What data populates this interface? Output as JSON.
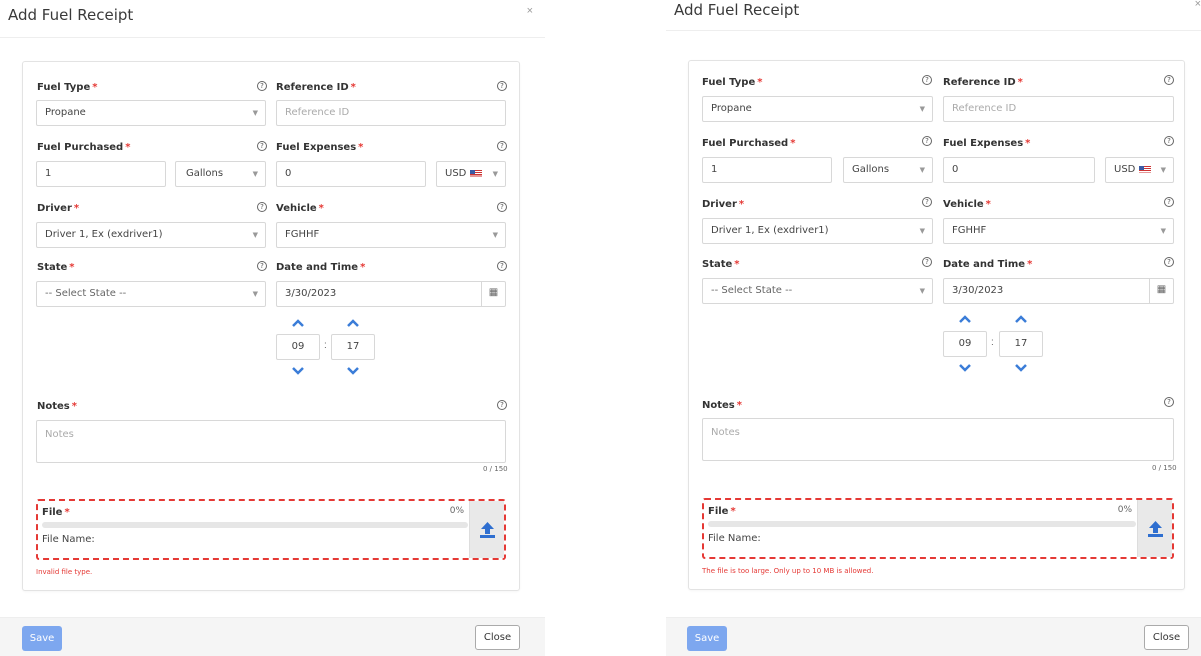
{
  "colors": {
    "required": "#e53935",
    "primary": "#7da7ef",
    "chevron": "#3b7dd8",
    "upload": "#2f6fd0"
  },
  "modal_left": {
    "title": "Add Fuel Receipt",
    "close_icon": "×",
    "help": "?",
    "fuel_type": {
      "label": "Fuel Type",
      "value": "Propane"
    },
    "reference_id": {
      "label": "Reference ID",
      "placeholder": "Reference ID"
    },
    "fuel_purchased": {
      "label": "Fuel Purchased",
      "value": "1",
      "unit": "Gallons"
    },
    "fuel_expenses": {
      "label": "Fuel Expenses",
      "value": "0",
      "currency": "USD"
    },
    "driver": {
      "label": "Driver",
      "value": "Driver 1, Ex (exdriver1)"
    },
    "vehicle": {
      "label": "Vehicle",
      "value": "FGHHF"
    },
    "state": {
      "label": "State",
      "value": "-- Select State --"
    },
    "date_time": {
      "label": "Date and Time",
      "date": "3/30/2023",
      "hour": "09",
      "minute": "17",
      "colon": ":"
    },
    "notes": {
      "label": "Notes",
      "placeholder": "Notes",
      "counter": "0 / 150"
    },
    "file": {
      "label": "File",
      "progress_text": "0%",
      "progress": 0,
      "file_name_label": "File Name:",
      "error": "Invalid file type."
    },
    "footer": {
      "save": "Save",
      "close": "Close"
    }
  },
  "modal_right": {
    "title": "Add Fuel Receipt",
    "close_icon": "×",
    "help": "?",
    "fuel_type": {
      "label": "Fuel Type",
      "value": "Propane"
    },
    "reference_id": {
      "label": "Reference ID",
      "placeholder": "Reference ID"
    },
    "fuel_purchased": {
      "label": "Fuel Purchased",
      "value": "1",
      "unit": "Gallons"
    },
    "fuel_expenses": {
      "label": "Fuel Expenses",
      "value": "0",
      "currency": "USD"
    },
    "driver": {
      "label": "Driver",
      "value": "Driver 1, Ex (exdriver1)"
    },
    "vehicle": {
      "label": "Vehicle",
      "value": "FGHHF"
    },
    "state": {
      "label": "State",
      "value": "-- Select State --"
    },
    "date_time": {
      "label": "Date and Time",
      "date": "3/30/2023",
      "hour": "09",
      "minute": "17",
      "colon": ":"
    },
    "notes": {
      "label": "Notes",
      "placeholder": "Notes",
      "counter": "0 / 150"
    },
    "file": {
      "label": "File",
      "progress_text": "0%",
      "progress": 0,
      "file_name_label": "File Name:",
      "error": "The file is too large. Only up to 10 MB is allowed."
    },
    "footer": {
      "save": "Save",
      "close": "Close"
    }
  }
}
